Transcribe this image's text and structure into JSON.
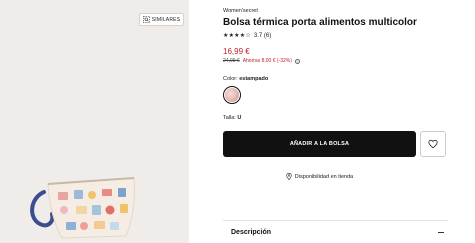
{
  "gallery": {
    "similar_label": "SIMILARES",
    "similar_icon": "image-search-icon"
  },
  "product": {
    "brand": "Women'secret",
    "title": "Bolsa térmica porta alimentos multicolor",
    "stars": "★★★★☆",
    "rating_text": "3.7 (6)",
    "price": "16,99 €",
    "old_price": "24,99 €",
    "savings": "Ahorras 8,00 € (-32%)",
    "color_prefix": "Color: ",
    "color_value": "estampado",
    "size_prefix": "Talla: ",
    "size_value": "U",
    "add_to_bag_label": "AÑADIR A LA BOLSA",
    "stock_text": "Disponibilidad en tienda",
    "description_label": "Descripción"
  },
  "colors": {
    "price_red": "#c0202f",
    "button_black": "#111111",
    "gallery_bg": "#f0ecea"
  }
}
